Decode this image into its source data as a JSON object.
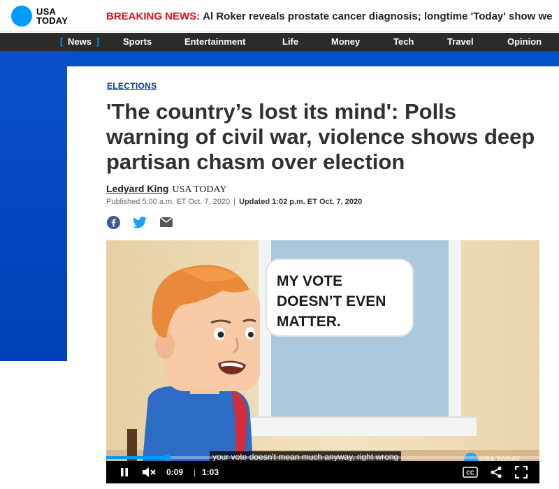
{
  "header": {
    "logo_text_line1": "USA",
    "logo_text_line2": "TODAY",
    "breaking_label": "BREAKING NEWS:",
    "breaking_text": "Al Roker reveals prostate cancer diagnosis; longtime 'Today' show we"
  },
  "nav": {
    "items": [
      {
        "label": "News",
        "active": true
      },
      {
        "label": "Sports"
      },
      {
        "label": "Entertainment"
      },
      {
        "label": "Life"
      },
      {
        "label": "Money"
      },
      {
        "label": "Tech"
      },
      {
        "label": "Travel"
      },
      {
        "label": "Opinion"
      }
    ],
    "active_bracket_open": "[",
    "active_bracket_close": "]"
  },
  "article": {
    "section": "ELECTIONS",
    "headline": "'The country’s lost its mind': Polls warning of civil war, violence shows deep partisan chasm over election",
    "author": "Ledyard King",
    "outlet": "USA TODAY",
    "published": "Published 5:00 a.m. ET Oct. 7, 2020",
    "updated": "Updated 1:02 p.m. ET Oct. 7, 2020"
  },
  "share": {
    "icons": [
      "facebook-icon",
      "twitter-icon",
      "email-icon"
    ]
  },
  "video": {
    "bubble_text": "MY VOTE\nDOESN’T EVEN\nMATTER.",
    "caption": "your vote doesn't mean much anyway, right wrong",
    "watermark": "USA TODAY",
    "current_time": "0:09",
    "separator": "|",
    "duration": "1:03",
    "progress": 0.14
  },
  "colors": {
    "brand_blue": "#009bff",
    "breaking_red": "#e0101e",
    "nav_bg": "#2b2b2b",
    "section_blue": "#0050c8"
  }
}
